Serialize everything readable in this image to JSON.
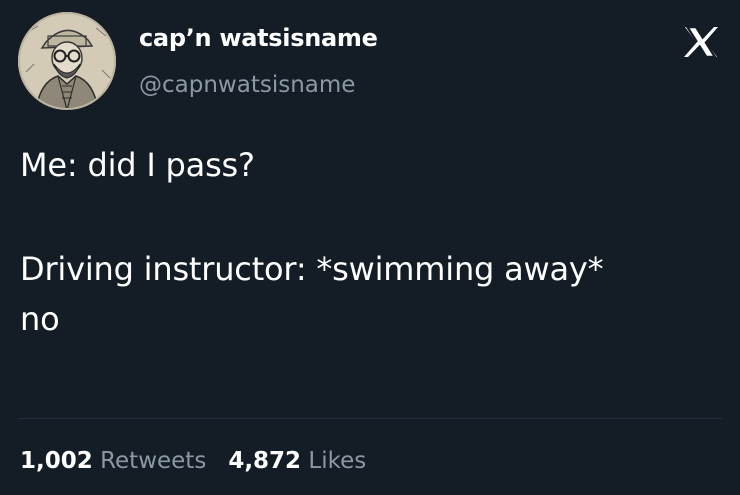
{
  "author": {
    "display_name": "cap’n watsisname",
    "handle": "@capnwatsisname",
    "avatar_icon": "sketch-portrait-avatar"
  },
  "tweet": {
    "line1": "Me: did I pass?",
    "line2": "Driving instructor: *swimming away*",
    "line3": "no"
  },
  "stats": {
    "retweets_count": "1,002",
    "retweets_label": "Retweets",
    "likes_count": "4,872",
    "likes_label": "Likes"
  },
  "icons": {
    "close": "x-logo-icon"
  },
  "colors": {
    "background": "#141d26",
    "text": "#ffffff",
    "muted": "#8b98a5",
    "divider": "#223140"
  }
}
